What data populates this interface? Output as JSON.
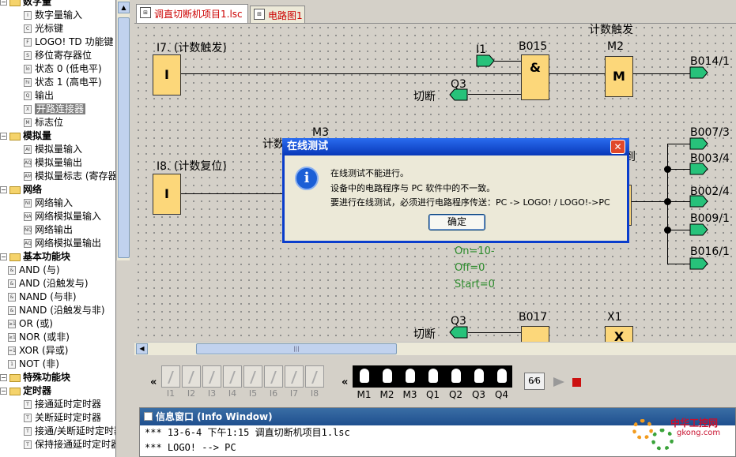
{
  "tree": {
    "items": [
      {
        "label": "数字量",
        "kind": "cat_sub",
        "icon": "folder-icon"
      },
      {
        "label": "数字量输入",
        "kind": "leaf",
        "ic": "I"
      },
      {
        "label": "光标键",
        "kind": "leaf",
        "ic": "C"
      },
      {
        "label": "LOGO! TD 功能键",
        "kind": "leaf",
        "ic": "F"
      },
      {
        "label": "移位寄存器位",
        "kind": "leaf",
        "ic": "S"
      },
      {
        "label": "状态 0 (低电平)",
        "kind": "leaf",
        "ic": "lo"
      },
      {
        "label": "状态 1 (高电平)",
        "kind": "leaf",
        "ic": "hi"
      },
      {
        "label": "输出",
        "kind": "leaf",
        "ic": "Q"
      },
      {
        "label": "开路连接器",
        "kind": "leaf",
        "ic": "X",
        "selected": true
      },
      {
        "label": "标志位",
        "kind": "leaf",
        "ic": "M"
      },
      {
        "label": "模拟量",
        "kind": "cat_sub"
      },
      {
        "label": "模拟量输入",
        "kind": "leaf",
        "ic": "AI"
      },
      {
        "label": "模拟量输出",
        "kind": "leaf",
        "ic": "AQ"
      },
      {
        "label": "模拟量标志 (寄存器",
        "kind": "leaf",
        "ic": "AM"
      },
      {
        "label": "网络",
        "kind": "cat_sub"
      },
      {
        "label": "网络输入",
        "kind": "leaf",
        "ic": "NI"
      },
      {
        "label": "网络模拟量输入",
        "kind": "leaf",
        "ic": "NA"
      },
      {
        "label": "网络输出",
        "kind": "leaf",
        "ic": "NQ"
      },
      {
        "label": "网络模拟量输出",
        "kind": "leaf",
        "ic": "AQ"
      },
      {
        "label": "基本功能块",
        "kind": "cat"
      },
      {
        "label": "AND (与)",
        "kind": "sub",
        "ic": "&"
      },
      {
        "label": "AND (沿触发与)",
        "kind": "sub",
        "ic": "&"
      },
      {
        "label": "NAND (与非)",
        "kind": "sub",
        "ic": "&"
      },
      {
        "label": "NAND (沿触发与非)",
        "kind": "sub",
        "ic": "&"
      },
      {
        "label": "OR (或)",
        "kind": "sub",
        "ic": "≥1"
      },
      {
        "label": "NOR (或非)",
        "kind": "sub",
        "ic": "≥1"
      },
      {
        "label": "XOR (异或)",
        "kind": "sub",
        "ic": "=1"
      },
      {
        "label": "NOT (非)",
        "kind": "sub",
        "ic": "1"
      },
      {
        "label": "特殊功能块",
        "kind": "cat"
      },
      {
        "label": "定时器",
        "kind": "cat_sub"
      },
      {
        "label": "接通延时定时器",
        "kind": "leaf",
        "ic": "T"
      },
      {
        "label": "关断延时定时器",
        "kind": "leaf",
        "ic": "T"
      },
      {
        "label": "接通/关断延时定时器",
        "kind": "leaf",
        "ic": "T"
      },
      {
        "label": "保持接通延时定时器",
        "kind": "leaf",
        "ic": "T"
      }
    ]
  },
  "tabs": [
    {
      "label": "调直切断机项目1.lsc",
      "active": true
    },
    {
      "label": "电路图1",
      "active": false
    }
  ],
  "diagram": {
    "i7_label": "I7. (计数触发)",
    "i8_label": "I8. (计数复位)",
    "i_block": "I",
    "i1_flag": "I1",
    "q3_flag_top": "Q3",
    "q3_flag_bottom": "Q3",
    "cut_top": "切断",
    "cut_bottom": "切断",
    "b015": "B015",
    "and_sym": "&",
    "m2": "M2",
    "m_block": "M",
    "count_trigger_top": "计数触发",
    "m3": "M3",
    "count_partial": "计数",
    "zhi": "到",
    "b014": "B014/1",
    "b007": "B007/3",
    "b003": "B003/4",
    "b002": "B002/4",
    "b009": "B009/1",
    "b016": "B016/1",
    "on_param": "On=10-",
    "off_param": "Off=0",
    "start_param": "Start=0",
    "b017": "B017",
    "x1": "X1",
    "x_block": "X",
    "block_color": "#fcd77a",
    "flag_color": "#27c27a"
  },
  "sim": {
    "inputs": [
      "I1",
      "I2",
      "I3",
      "I4",
      "I5",
      "I6",
      "I7",
      "I8"
    ],
    "outputs": [
      "M1",
      "M2",
      "M3",
      "Q1",
      "Q2",
      "Q3",
      "Q4"
    ]
  },
  "info": {
    "title": "信息窗口 (Info Window)",
    "lines": [
      "*** 13-6-4 下午1:15 调直切断机项目1.lsc",
      "*** LOGO! --> PC"
    ]
  },
  "dialog": {
    "title": "在线测试",
    "lines": [
      "在线测试不能进行。",
      "设备中的电路程序与 PC 软件中的不一致。",
      "要进行在线测试，必须进行电路程序传送：PC -> LOGO! / LOGO!->PC"
    ],
    "ok": "确定"
  },
  "logo": {
    "text": "中华工控网",
    "url": "gkong.com"
  }
}
